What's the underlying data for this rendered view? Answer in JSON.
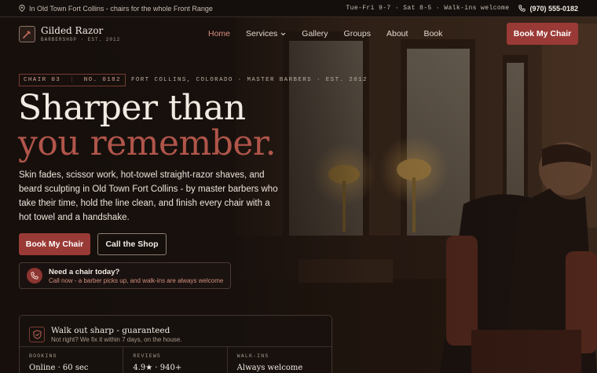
{
  "topbar": {
    "location_text": "In Old Town Fort Collins - chairs for the whole Front Range",
    "hours": "Tue-Fri 9-7 · Sat 8-5 · Walk-ins welcome",
    "phone": "(970) 555-0182"
  },
  "brand": {
    "name": "Gilded Razor",
    "tagline": "BARBERSHOP · EST. 2012"
  },
  "nav": {
    "items": [
      "Home",
      "Services",
      "Gallery",
      "Groups",
      "About",
      "Book"
    ],
    "active": "Home",
    "cta": "Book My Chair"
  },
  "hero": {
    "tag_chair": "CHAIR 03",
    "tag_no": "NO. 0182",
    "eyebrow": "FORT COLLINS, COLORADO · MASTER BARBERS · EST. 2012",
    "headline_1": "Sharper than",
    "headline_2": "you remember.",
    "lead": "Skin fades, scissor work, hot-towel straight-razor shaves, and beard sculpting in Old Town Fort Collins - by master barbers who take their time, hold the line clean, and finish every chair with a hot towel and a handshake.",
    "primary_cta": "Book My Chair",
    "secondary_cta": "Call the Shop",
    "call_title": "Need a chair today?",
    "call_sub": "Call now - a barber picks up, and walk-ins are always welcome"
  },
  "guarantee": {
    "title": "Walk out sharp - guaranteed",
    "subtitle": "Not right? We fix it within 7 days, on the house.",
    "stats": [
      {
        "label": "BOOKING",
        "value": "Online · 60 sec"
      },
      {
        "label": "REVIEWS",
        "value": "4.9★ · 940+"
      },
      {
        "label": "WALK-INS",
        "value": "Always welcome"
      }
    ]
  },
  "colors": {
    "accent": "#9a3a36",
    "accent_text": "#b0554a",
    "background": "#1b1411"
  }
}
